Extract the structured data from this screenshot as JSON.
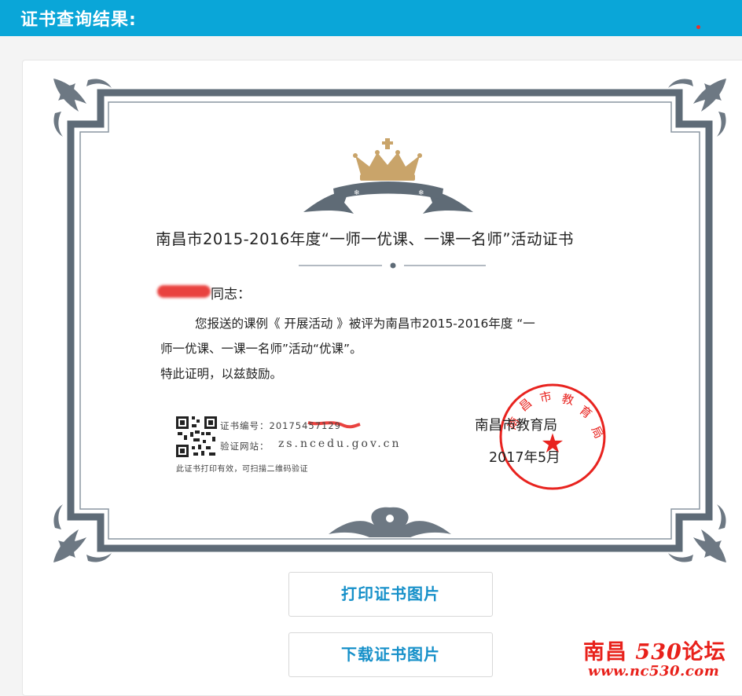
{
  "header": {
    "title": "证书查询结果:"
  },
  "certificate": {
    "title": "南昌市2015-2016年度“一师一优课、一课一名师”活动证书",
    "greeting_suffix": "同志：",
    "body_line1": "您报送的课例《  开展活动  》被评为南昌市2015-2016年度 “一",
    "body_line2": "师一优课、一课一名师”活动“优课”。",
    "body_line3": "特此证明，以兹鼓励。",
    "cert_number_label": "证书编号：20175457129",
    "verify_site_label": "验证网站：",
    "verify_site_url": "zs.ncedu.gov.cn",
    "note": "此证书打印有效，可扫描二维码验证",
    "issuer": "南昌市教育局",
    "date": "2017年5月",
    "seal_text": "南昌市教育局",
    "colors": {
      "border": "#5e6b77",
      "crown": "#c9a46a",
      "seal": "#e8231f"
    }
  },
  "buttons": {
    "print_label": "打印证书图片",
    "download_label": "下载证书图片"
  },
  "watermark": {
    "site_name": "南昌",
    "site_num": "530",
    "site_suffix": "论坛",
    "site_url": "www.nc530.com"
  }
}
